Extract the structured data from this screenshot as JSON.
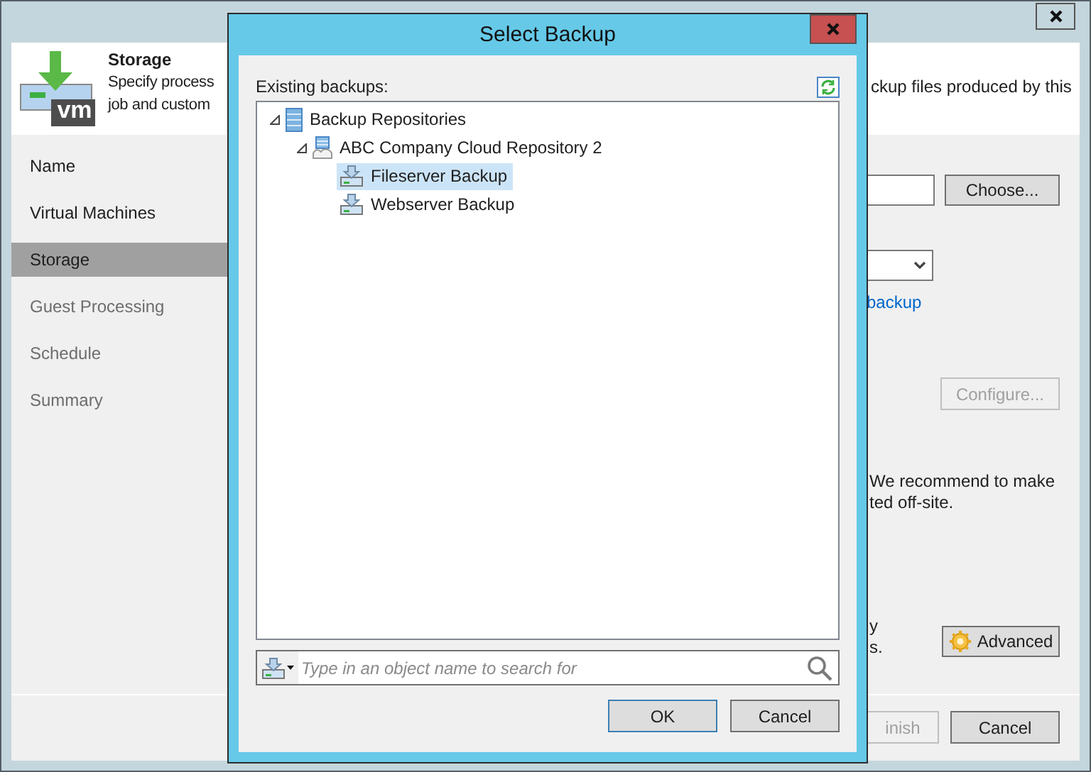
{
  "wizard": {
    "header": {
      "logo_text": "vm",
      "title": "Storage",
      "description_left": [
        "Specify process",
        "job and custom"
      ],
      "description_right": "ckup files produced by this"
    },
    "steps": [
      {
        "label": "Name",
        "selected": false,
        "disabled": false
      },
      {
        "label": "Virtual Machines",
        "selected": false,
        "disabled": false
      },
      {
        "label": "Storage",
        "selected": true,
        "disabled": false
      },
      {
        "label": "Guest Processing",
        "selected": false,
        "disabled": true
      },
      {
        "label": "Schedule",
        "selected": false,
        "disabled": true
      },
      {
        "label": "Summary",
        "selected": false,
        "disabled": true
      }
    ],
    "content": {
      "choose_button": "Choose...",
      "link": "backup",
      "configure_button": {
        "label": "Configure...",
        "disabled": true
      },
      "note_lines": [
        "We recommend to make",
        "ted off-site."
      ],
      "fragment_lines": [
        "y",
        "s."
      ],
      "advanced_button": "Advanced"
    },
    "footer": {
      "buttons": [
        {
          "label": "inish",
          "disabled": true
        },
        {
          "label": "Cancel",
          "disabled": false
        }
      ]
    }
  },
  "dialog": {
    "title": "Select Backup",
    "tree_label": "Existing backups:",
    "tree": [
      {
        "label": "Backup Repositories",
        "kind": "repositories",
        "expanded": true,
        "selected": false,
        "children": [
          {
            "label": "ABC Company Cloud Repository 2",
            "kind": "cloud-repository",
            "expanded": true,
            "selected": false,
            "children": [
              {
                "label": "Fileserver Backup",
                "kind": "backup",
                "selected": true
              },
              {
                "label": "Webserver Backup",
                "kind": "backup",
                "selected": false
              }
            ]
          }
        ]
      }
    ],
    "search": {
      "placeholder": "Type in an object name to search for"
    },
    "buttons": [
      {
        "label": "OK",
        "default": true
      },
      {
        "label": "Cancel",
        "default": false
      }
    ]
  }
}
